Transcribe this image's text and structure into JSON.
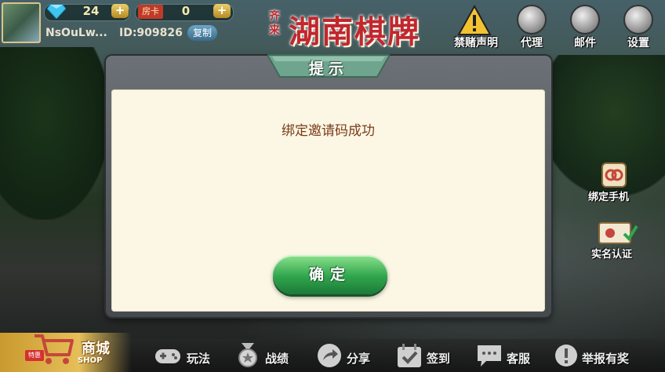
{
  "header": {
    "diamond_count": "24",
    "card_label": "房卡",
    "card_count": "0",
    "nickname": "NsOuLw...",
    "user_id": "ID:909826",
    "copy_label": "复制",
    "logo_title": "湖南棋牌",
    "logo_sub": "齐来",
    "nav": [
      {
        "label": "禁赌声明"
      },
      {
        "label": "代理"
      },
      {
        "label": "邮件"
      },
      {
        "label": "设置"
      }
    ]
  },
  "side": {
    "bind_phone": "绑定手机",
    "real_name": "实名认证"
  },
  "dialog": {
    "title": "提示",
    "message": "绑定邀请码成功",
    "confirm_label": "确定"
  },
  "bottom": {
    "shop_label": "商城",
    "shop_sub": "SHOP",
    "shop_tag": "特惠",
    "items": [
      {
        "label": "玩法"
      },
      {
        "label": "战绩"
      },
      {
        "label": "分享"
      },
      {
        "label": "签到"
      },
      {
        "label": "客服"
      },
      {
        "label": "举报有奖"
      }
    ]
  },
  "colors": {
    "dialog_bg": "#fbf7e4",
    "message_text": "#7a3b1a",
    "confirm_green": "#2fa54c",
    "logo_red": "#c1272d"
  }
}
